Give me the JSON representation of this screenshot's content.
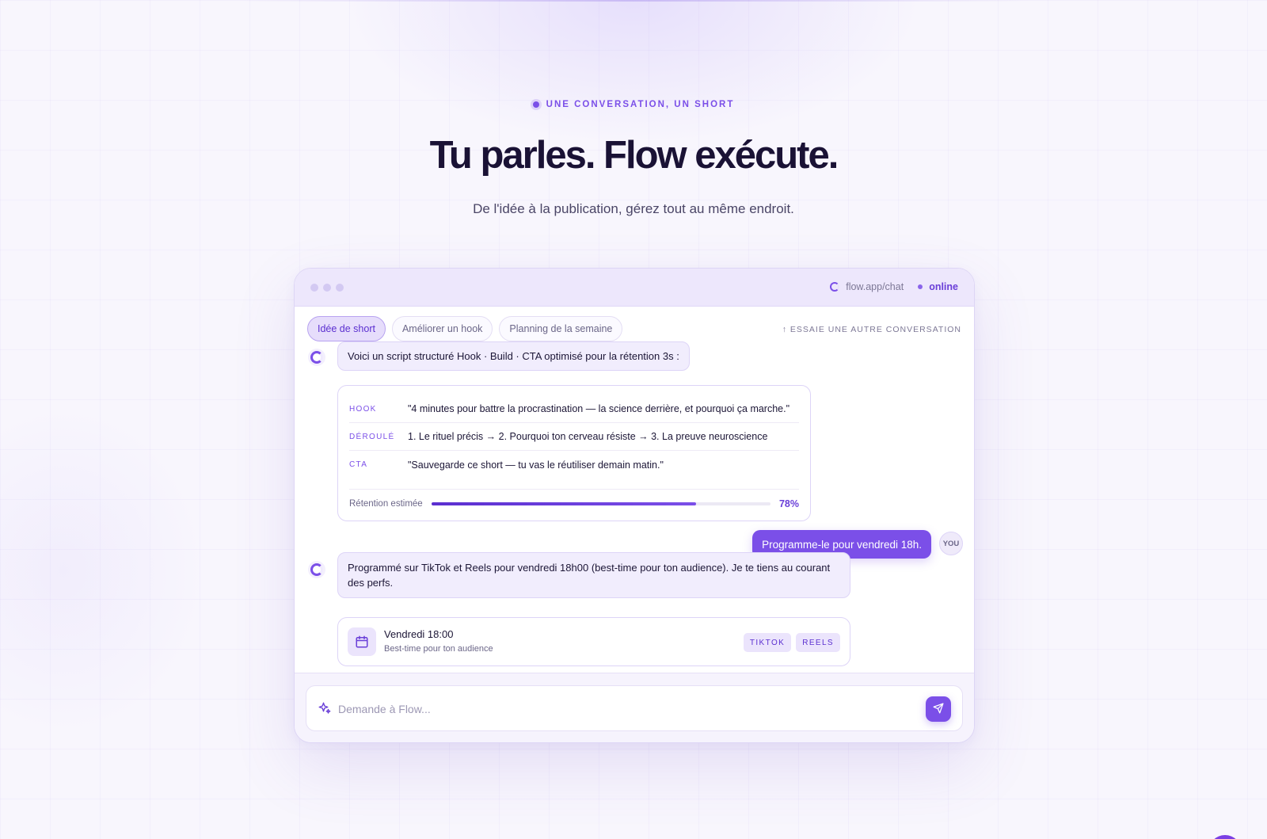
{
  "hero": {
    "eyebrow": "UNE CONVERSATION, UN SHORT",
    "title": "Tu parles. Flow exécute.",
    "subtitle": "De l'idée à la publication, gérez tout au même endroit."
  },
  "window": {
    "url": "flow.app/chat",
    "status": "online"
  },
  "chips": [
    {
      "label": "Idée de short",
      "active": true
    },
    {
      "label": "Améliorer un hook",
      "active": false
    },
    {
      "label": "Planning de la semaine",
      "active": false
    }
  ],
  "other_conversation": "↑ ESSAIE UNE AUTRE CONVERSATION",
  "messages": {
    "bot_1": "Voici un script structuré Hook · Build · CTA optimisé pour la rétention 3s :",
    "script": {
      "rows": [
        {
          "label": "HOOK",
          "text": "\"4 minutes pour battre la procrastination — la science derrière, et pourquoi ça marche.\""
        },
        {
          "label": "DÉROULÉ",
          "text": "1. Le rituel précis → 2. Pourquoi ton cerveau résiste → 3. La preuve neuroscience"
        },
        {
          "label": "CTA",
          "text": "\"Sauvegarde ce short — tu vas le réutiliser demain matin.\""
        }
      ],
      "retention_label": "Rétention estimée",
      "retention_value": "78%",
      "retention_fraction": 0.78
    },
    "user_1": "Programme-le pour vendredi 18h.",
    "user_avatar": "YOU",
    "bot_2": "Programmé sur TikTok et Reels pour vendredi 18h00 (best-time pour ton audience). Je te tiens au courant des perfs.",
    "schedule": {
      "title": "Vendredi 18:00",
      "subtitle": "Best-time pour ton audience",
      "tags": [
        "TIKTOK",
        "REELS"
      ]
    }
  },
  "input": {
    "placeholder": "Demande à Flow..."
  },
  "colors": {
    "accent": "#7b4fe8",
    "heading": "#1a1235",
    "bubble_bg": "#f1edfd"
  },
  "icons": {
    "input": "sparkle-icon",
    "send": "send-icon",
    "schedule": "calendar-icon",
    "bot": "flow-logo-icon"
  }
}
